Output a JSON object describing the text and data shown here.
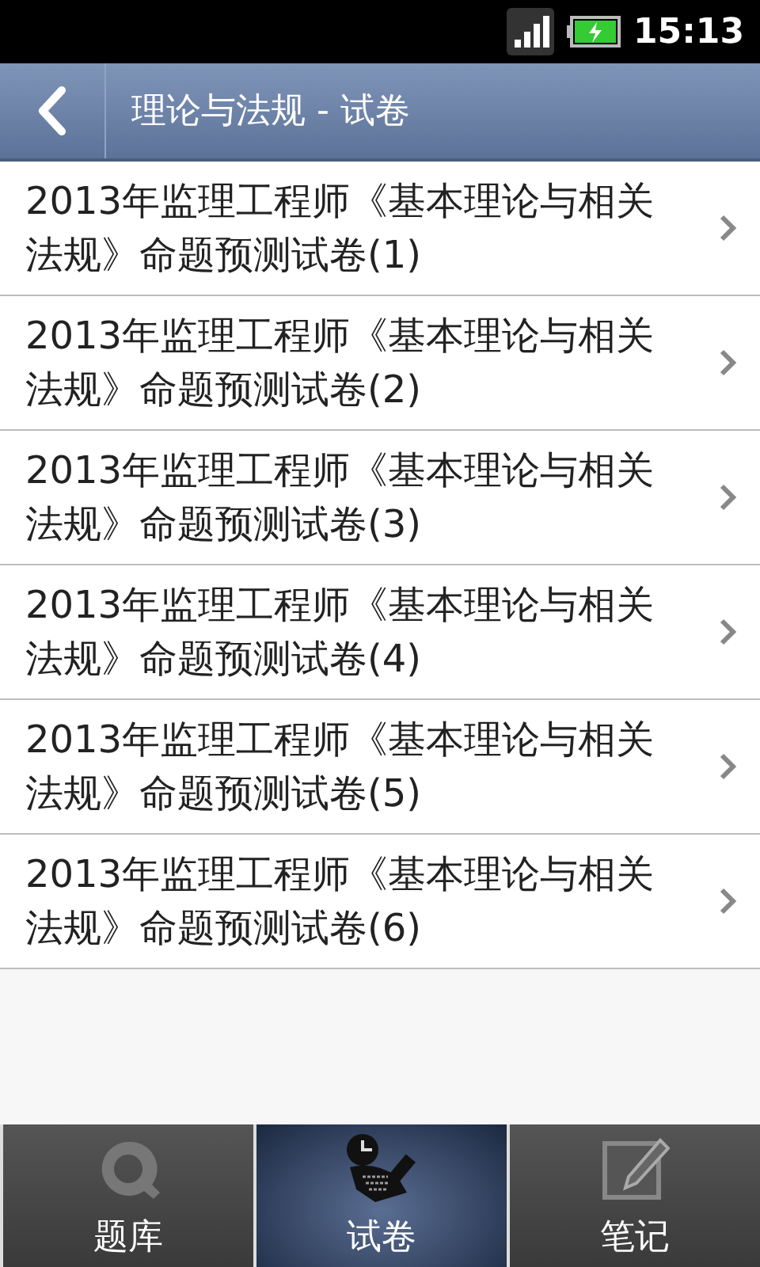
{
  "status_bar": {
    "time": "15:13"
  },
  "header": {
    "title": "理论与法规 - 试卷"
  },
  "list": [
    {
      "title": "2013年监理工程师《基本理论与相关法规》命题预测试卷(1)"
    },
    {
      "title": "2013年监理工程师《基本理论与相关法规》命题预测试卷(2)"
    },
    {
      "title": "2013年监理工程师《基本理论与相关法规》命题预测试卷(3)"
    },
    {
      "title": "2013年监理工程师《基本理论与相关法规》命题预测试卷(4)"
    },
    {
      "title": "2013年监理工程师《基本理论与相关法规》命题预测试卷(5)"
    },
    {
      "title": "2013年监理工程师《基本理论与相关法规》命题预测试卷(6)"
    }
  ],
  "tabs": [
    {
      "label": "题库",
      "kind": "bank",
      "selected": false
    },
    {
      "label": "试卷",
      "kind": "paper",
      "selected": true
    },
    {
      "label": "笔记",
      "kind": "note",
      "selected": false
    }
  ]
}
